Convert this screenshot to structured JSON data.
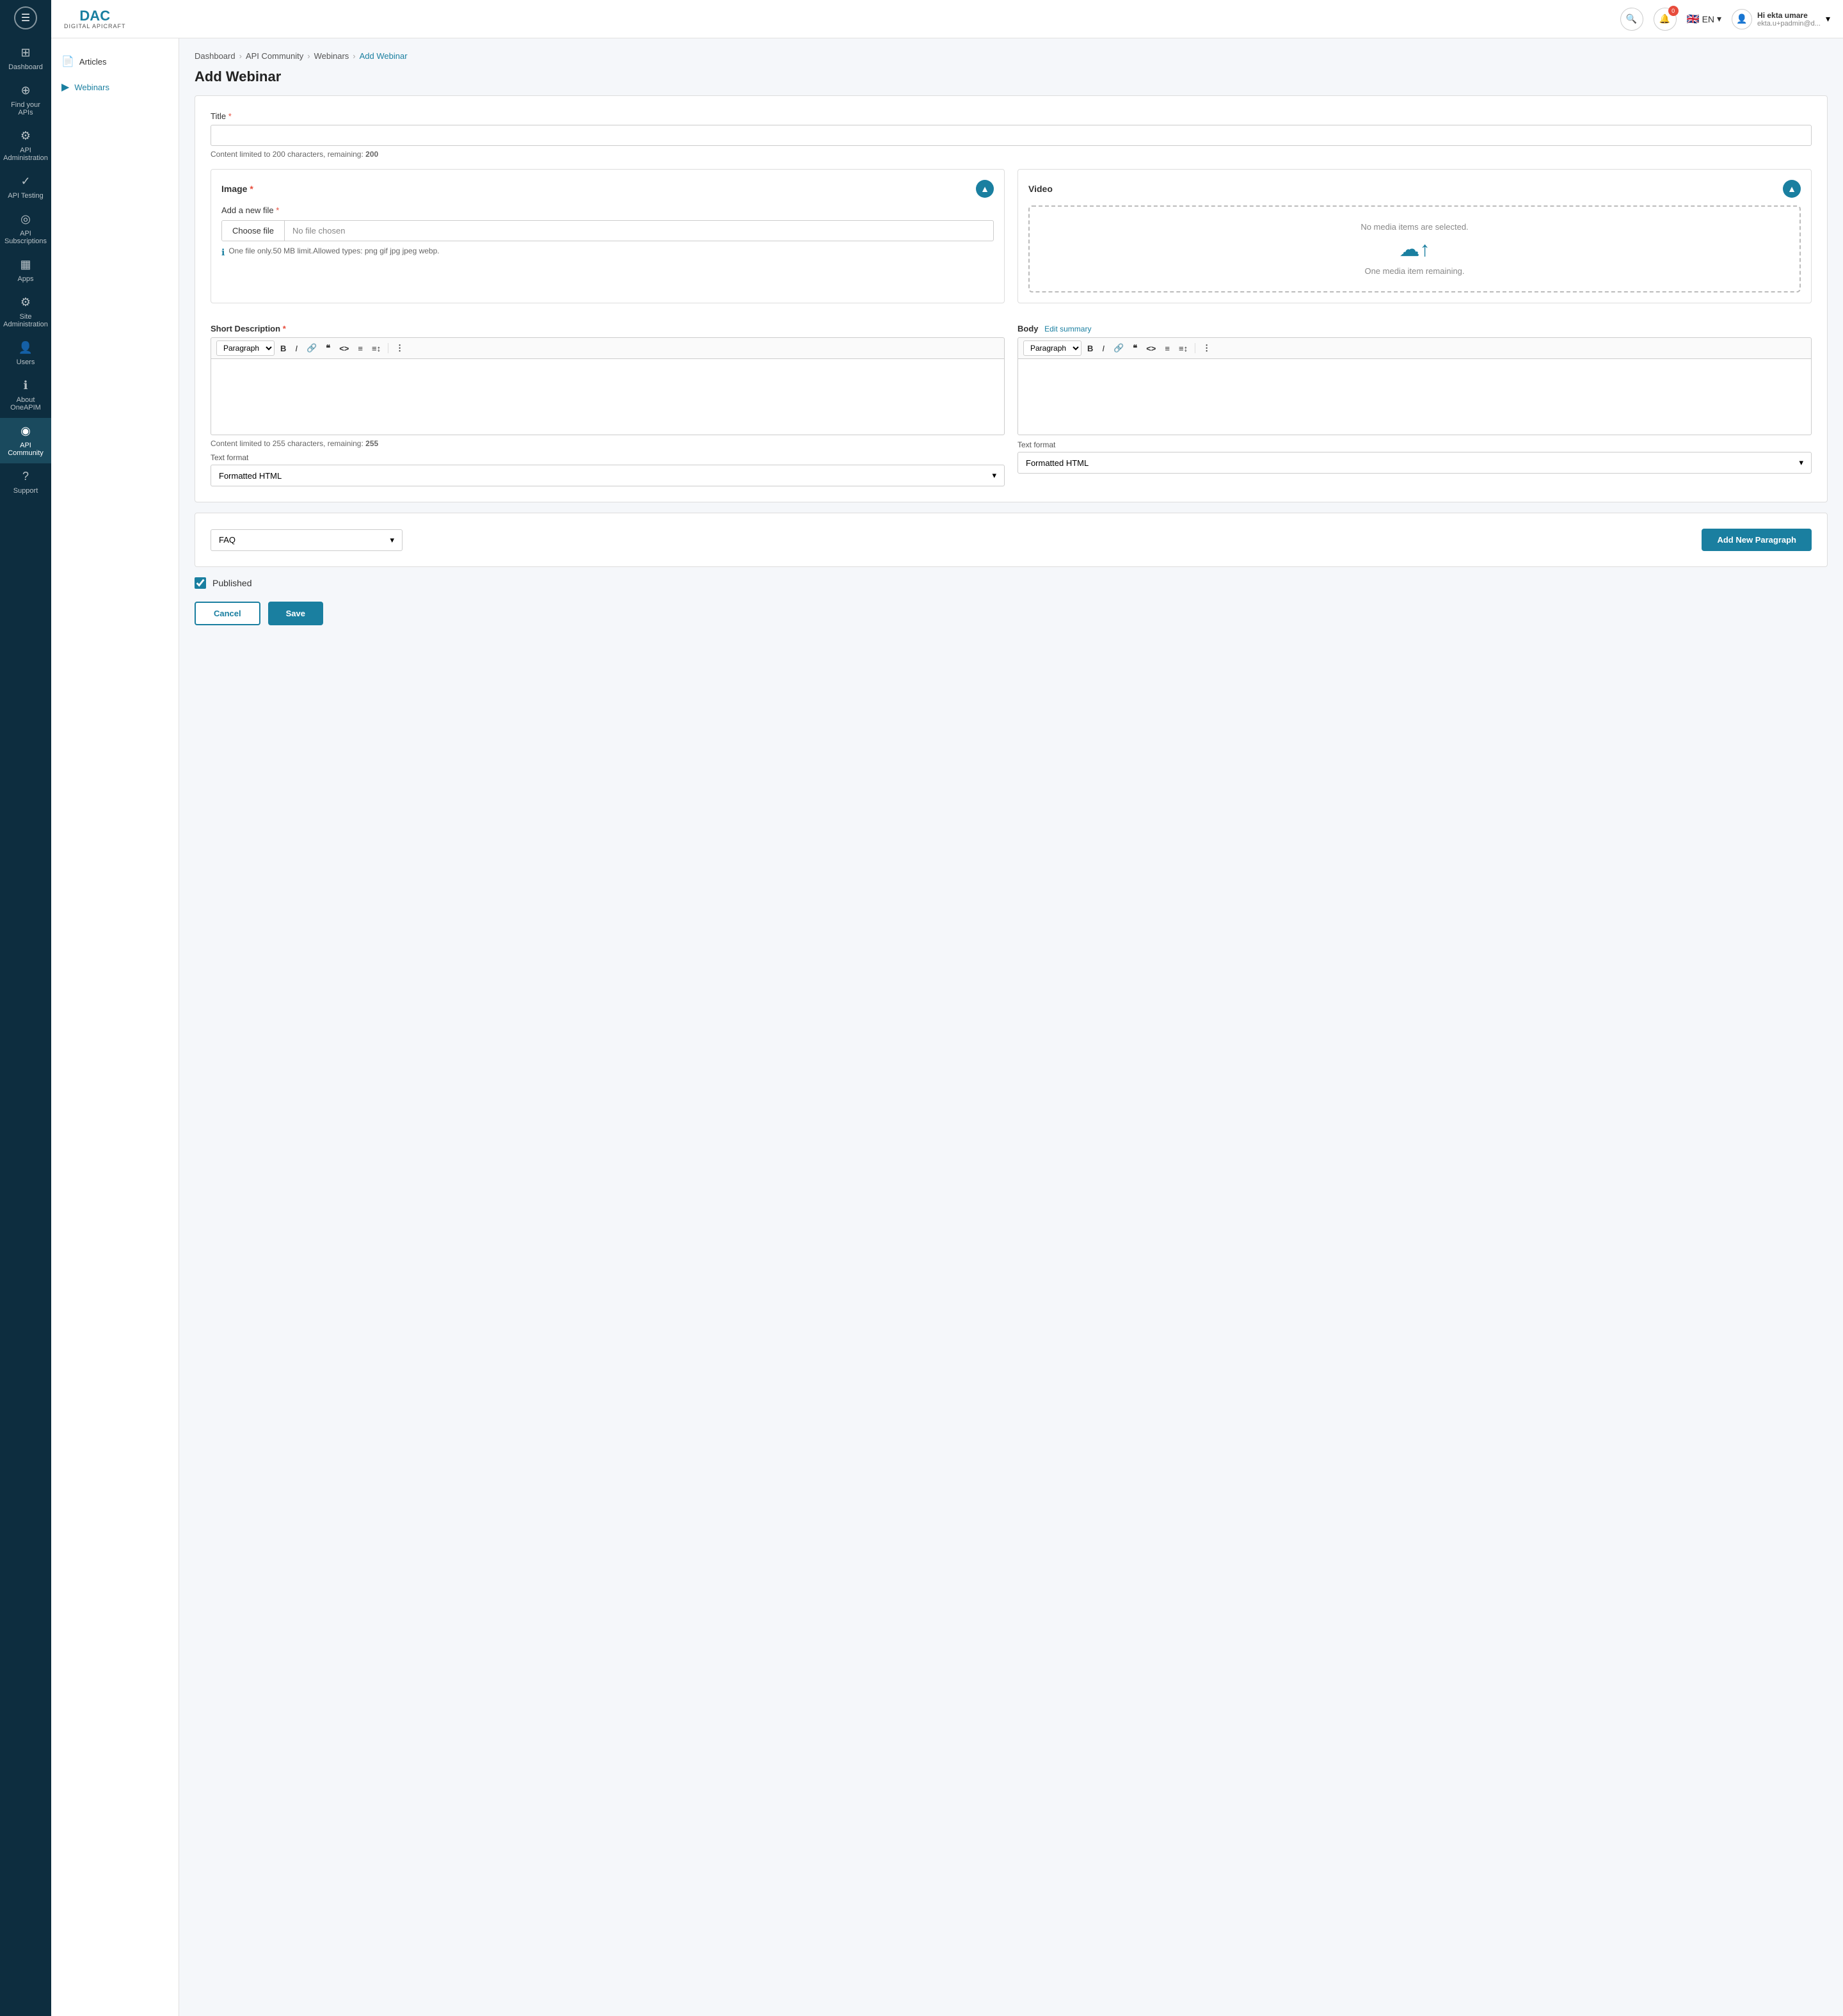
{
  "app": {
    "logo": "DAC",
    "logo_sub": "DIGITAL APICRAFT"
  },
  "topnav": {
    "lang": "EN",
    "user_name": "Hi ekta umare",
    "user_email": "ekta.u+padmin@d...",
    "notif_count": "0"
  },
  "sidebar": {
    "items": [
      {
        "id": "dashboard",
        "label": "Dashboard",
        "icon": "⊞"
      },
      {
        "id": "find-apis",
        "label": "Find your APIs",
        "icon": "⊕"
      },
      {
        "id": "api-admin",
        "label": "API Administration",
        "icon": "⚙"
      },
      {
        "id": "api-testing",
        "label": "API Testing",
        "icon": "✓"
      },
      {
        "id": "api-subscriptions",
        "label": "API Subscriptions",
        "icon": "◎"
      },
      {
        "id": "apps",
        "label": "Apps",
        "icon": "▦"
      },
      {
        "id": "site-admin",
        "label": "Site Administration",
        "icon": "⚙"
      },
      {
        "id": "users",
        "label": "Users",
        "icon": "👤"
      },
      {
        "id": "about-oneapim",
        "label": "About OneAPIM",
        "icon": "ℹ"
      },
      {
        "id": "api-community",
        "label": "API Community",
        "icon": "◉"
      },
      {
        "id": "support",
        "label": "Support",
        "icon": "?"
      }
    ]
  },
  "left_nav": {
    "items": [
      {
        "id": "articles",
        "label": "Articles",
        "icon": "📄"
      },
      {
        "id": "webinars",
        "label": "Webinars",
        "icon": "▶",
        "active": true
      }
    ]
  },
  "breadcrumb": {
    "items": [
      {
        "label": "Dashboard"
      },
      {
        "label": "API Community"
      },
      {
        "label": "Webinars"
      },
      {
        "label": "Add Webinar",
        "active": true
      }
    ]
  },
  "page_title": "Add Webinar",
  "form": {
    "title_label": "Title",
    "title_placeholder": "",
    "char_limit_text": "Content limited to 200 characters, remaining:",
    "char_limit_value": "200",
    "image_section": {
      "title": "Image",
      "add_file_label": "Add a new file",
      "choose_file_btn": "Choose file",
      "no_file_text": "No file chosen",
      "file_info": "One file only.50 MB limit.Allowed types: png gif jpg jpeg webp."
    },
    "video_section": {
      "title": "Video",
      "no_media_text": "No media items are selected.",
      "remaining_text": "One media item remaining."
    },
    "short_desc": {
      "label": "Short Description",
      "toolbar": {
        "format_select": "Paragraph",
        "bold": "B",
        "italic": "I",
        "link": "🔗",
        "quote": "❝",
        "code": "<>",
        "list_ul": "≡",
        "list_ol": "≡↕",
        "more": "⋮"
      },
      "char_limit_text": "Content limited to 255 characters, remaining:",
      "char_limit_value": "255",
      "text_format_label": "Text format",
      "text_format_value": "Formatted HTML"
    },
    "body": {
      "label": "Body",
      "edit_summary_label": "Edit summary",
      "toolbar": {
        "format_select": "Paragraph",
        "bold": "B",
        "italic": "I",
        "link": "🔗",
        "quote": "❝",
        "code": "<>",
        "list_ul": "≡",
        "list_ol": "≡↕",
        "more": "⋮"
      },
      "text_format_label": "Text format",
      "text_format_value": "Formatted HTML"
    },
    "faq": {
      "label": "FAQ",
      "add_paragraph_btn": "Add New Paragraph"
    },
    "published_label": "Published",
    "cancel_btn": "Cancel",
    "save_btn": "Save"
  }
}
